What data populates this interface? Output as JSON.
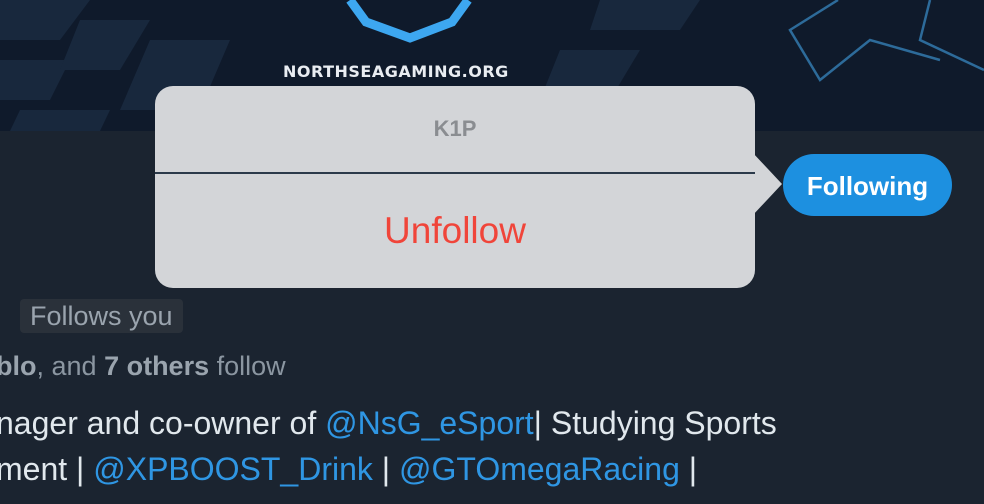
{
  "banner": {
    "caption": "NORTHSEAGAMING.ORG"
  },
  "popover": {
    "title": "K1P",
    "action_label": "Unfollow"
  },
  "profile": {
    "follow_button_label": "Following",
    "follows_you_label": "Follows you",
    "followers": {
      "name_fragment": "blo",
      "sep": ", and ",
      "count_text": "7 others",
      "suffix": " follow"
    },
    "bio": {
      "line1_prefix": "nager and co-owner of ",
      "line1_mention": "@NsG_eSport",
      "line1_suffix": "| Studying Sports",
      "line2_prefix": "ment | ",
      "line2_mention1": "@XPBOOST_Drink",
      "line2_sep": " | ",
      "line2_mention2": "@GTOmegaRacing",
      "line2_suffix": " |"
    }
  },
  "colors": {
    "accent": "#1d90e0",
    "destructive": "#f0453a",
    "background": "#1b2430"
  }
}
